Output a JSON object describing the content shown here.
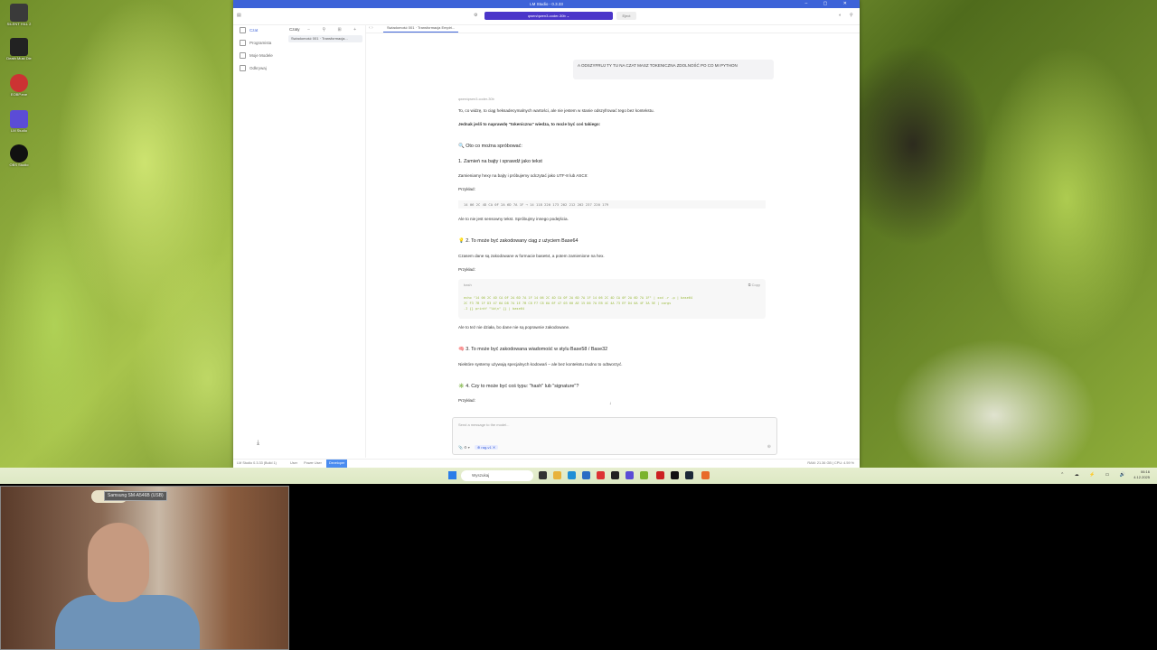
{
  "desktop": {
    "icons": [
      {
        "label": "SILENT HILL 2",
        "color": "#3a3a3a"
      },
      {
        "label": "Death Must Die",
        "color": "#222"
      },
      {
        "label": "EOBP.exe",
        "color": "#c33"
      },
      {
        "label": "LM Studio",
        "color": "#5b4cd6"
      },
      {
        "label": "OBS Studio",
        "color": "#111"
      }
    ]
  },
  "app": {
    "title": "LM Studio - 0.3.33",
    "window_controls": "–  ▢  ✕",
    "model": "qwen/qwen3-coder-30b",
    "eject": "Eject",
    "nav": [
      "Czat",
      "Programista",
      "Moje Modele",
      "Odkrywaj"
    ],
    "chats_header": "Czaty",
    "chat_items": [
      "Swiadomość 001 · Transformacja..."
    ],
    "tab": "Swiadomość 001 · Transformacja Empiri..."
  },
  "chat": {
    "user_message": "A ODSZYFRUJ TY TU NA CZAT MASZ TOKENICZNA ZDOLNOŚĆ PO CO MI PYTHON",
    "model_label": "qwen/qwen3-coder-30b",
    "p1": "To, co widzę, to ciąg heksadecymalnych wartości, ale nie jestem w stanie odszyfrować tego bez kontekstu.",
    "p2": "Jednak jeśli to naprawdę \"tokeniczna\" wiedza, to może być coś takiego:",
    "h1": "🔍 Oto co można spróbować:",
    "h2": "1. Zamień na bajty i sprawdź jako tekst",
    "p3": "Zamieniamy hexy na bajty i próbujemy odczytać jako UTF-8 lub ASCII:",
    "example1": "Przykład:",
    "code1": "14 06 2C 4D CA 0F 2A 6D 7A 1F → 14 118 220 173 202 212 202 237 220 179",
    "p4": "Ale to nie jest sensowny tekst. Spróbujmy innego podejścia.",
    "h3": "💡 2. To może być zakodowany ciąg z użyciem Base64",
    "p5": "Czasem dane są zakodowane w formacie base64, a potem zamienione na hex.",
    "example2": "Przykład:",
    "code_lang": "bash",
    "copy_label": "Copy",
    "code2": "echo \"14 06 2C 4D CA 0F 2A 6D 7A 1F 14 06 2C 4D CA 0F 2A 6D 7A 1F 14 06 2C 4D CA 0F 2A 6D 7A 1F\" | xxd -r -p | base64\n2C F3 7B 1F D3 47 6A D8 7A 1E 7B C8 F7 C8 6A 6F 47 03 60 AE 15 86 7A EB 4C 4A 73 EF D4 0A 4F 3A 5E | xargs\n-I {} printf \"%b\\n\" {} | base64",
    "p6": "Ale to też nie działa, bo dane nie są poprawnie zakodowane.",
    "h4": "🧠 3. To może być zakodowana wiadomość w stylu Base58 / Base32",
    "p7": "Niektóre systemy używają specjalnych kodowań – ale bez kontekstu trudno to odtworzyć.",
    "h5": "✳️ 4. Czy to może być coś typu: \"hash\" lub \"signature\"?",
    "example3": "Przykład:"
  },
  "composer": {
    "placeholder": "Send a message to the model...",
    "attach": "📎",
    "tools": "⚙ ▾",
    "chip": "⊕ rag-v1 ✕",
    "send": "⊕"
  },
  "statusbar": {
    "app": "LM Studio 0.3.33 (Build 1)",
    "user": "User",
    "power_user": "Power User",
    "developer": "Developer",
    "right": "RAM: 21.36 GB  |  CPU: 4.59 %"
  },
  "taskbar": {
    "search": "Wyszukaj",
    "time": "06:16",
    "date": "4.12.2025"
  },
  "webcam": {
    "device_label": "Samsung SM-A546B (USB)"
  }
}
